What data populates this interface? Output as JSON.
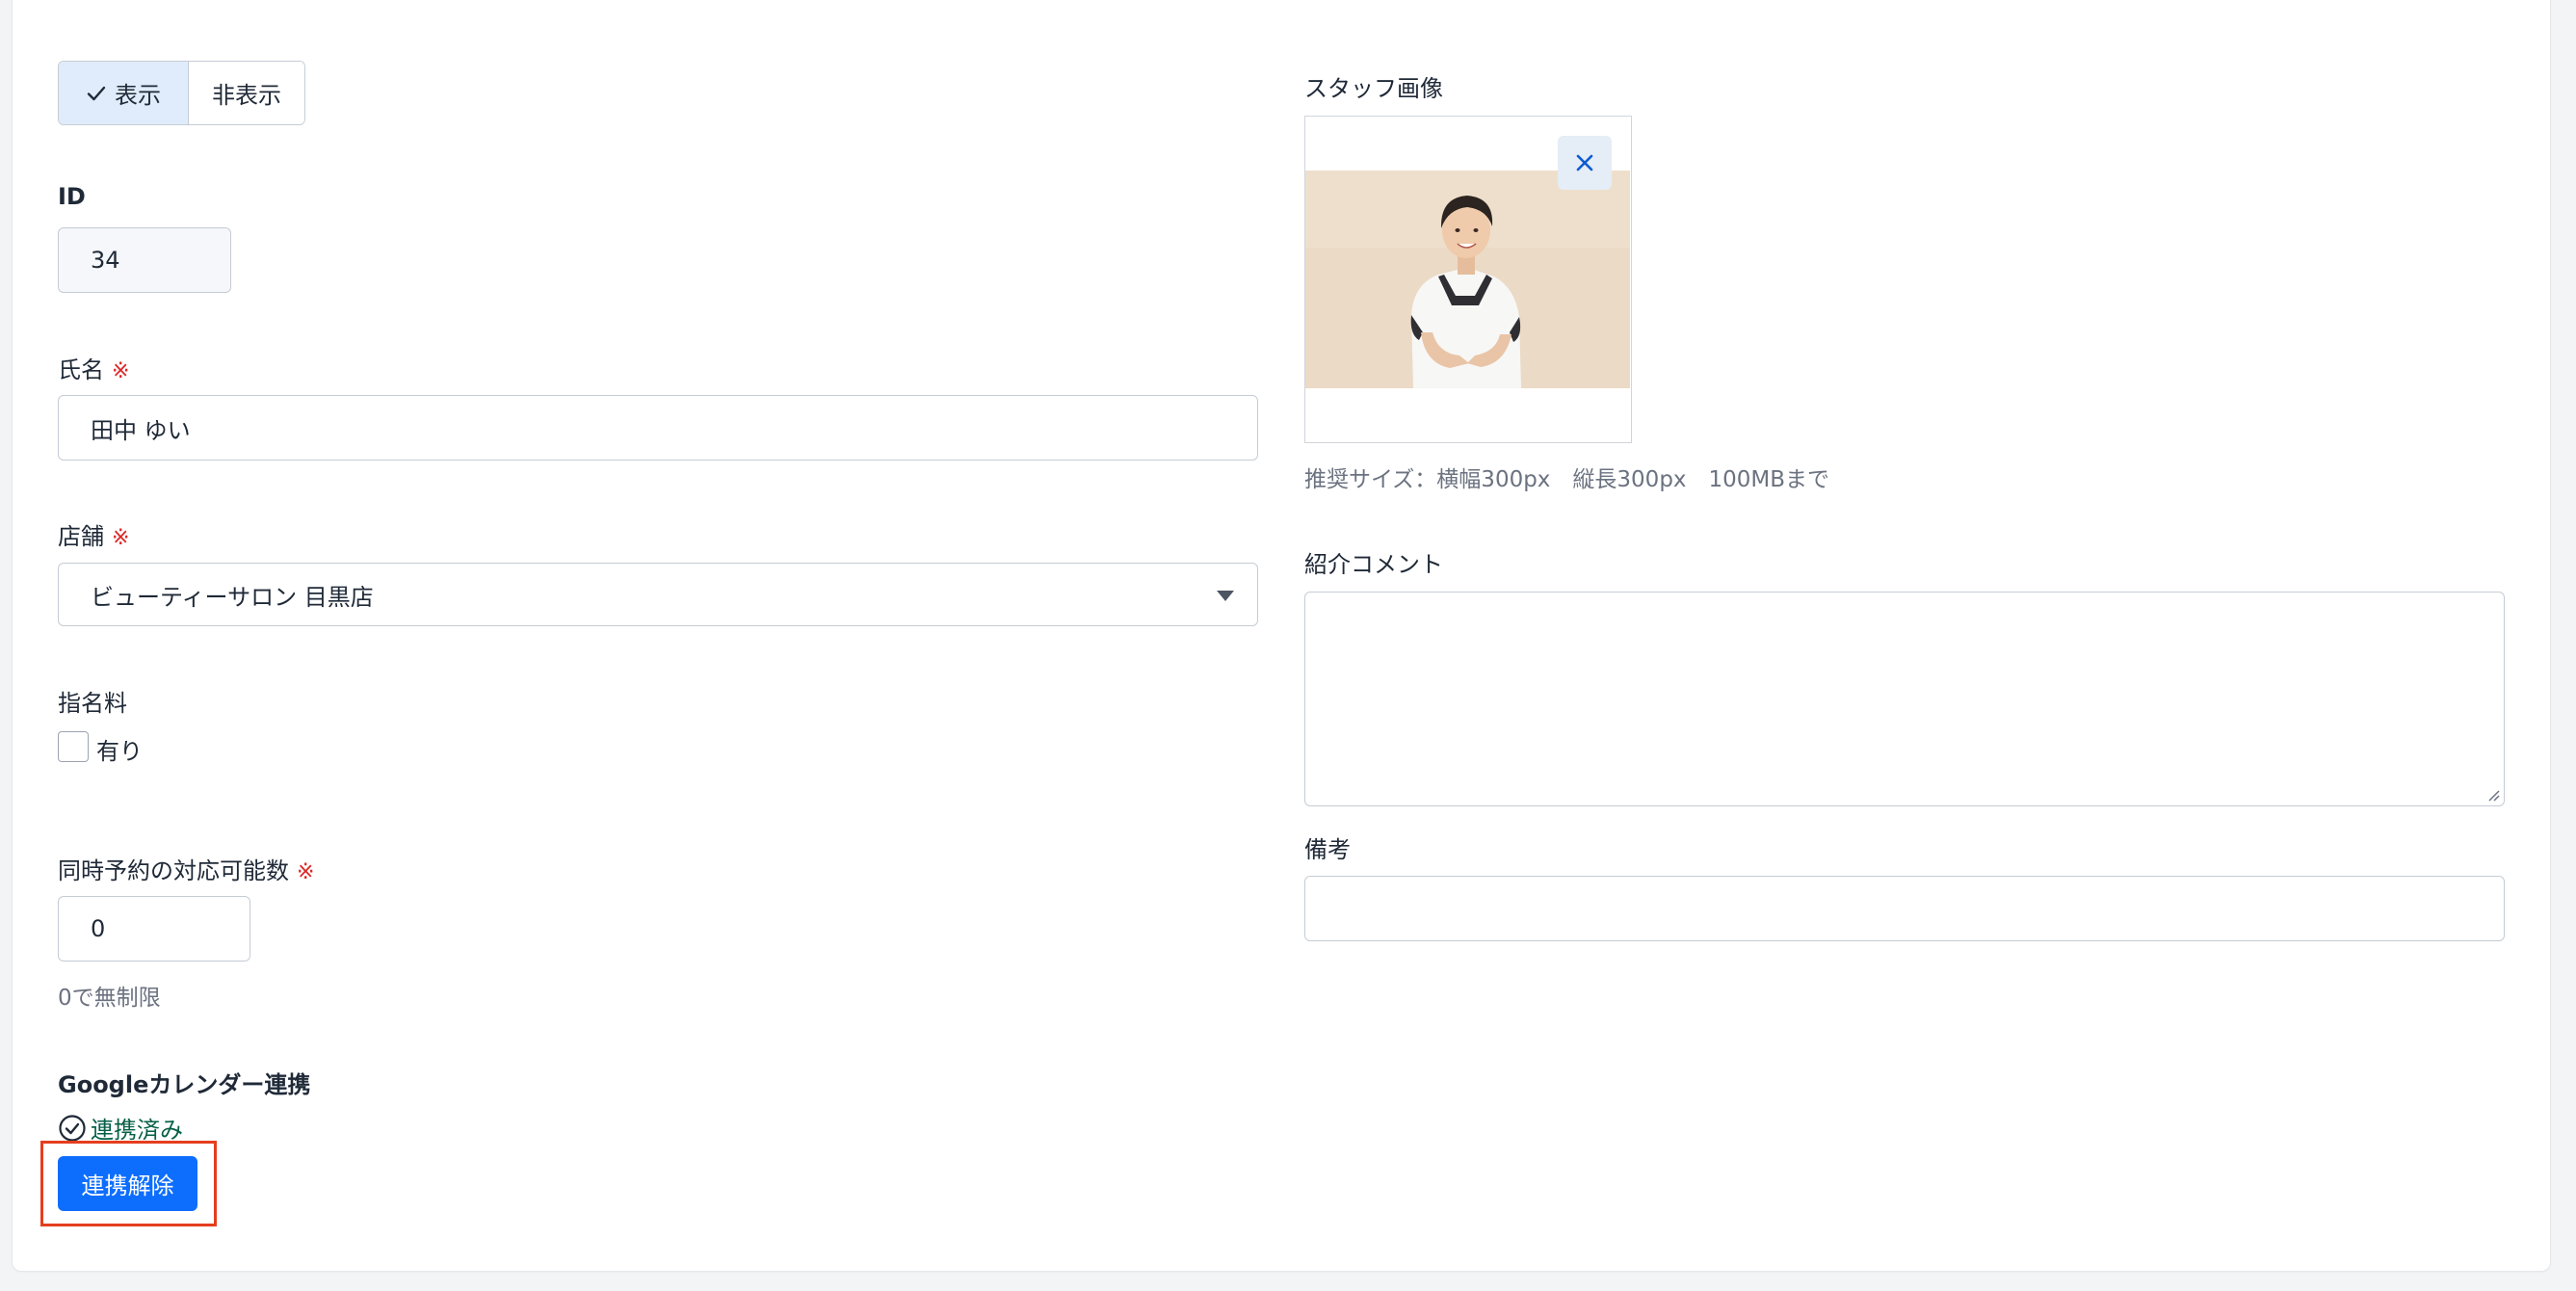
{
  "visibility_toggle": {
    "show_label": "表示",
    "hide_label": "非表示",
    "selected": "表示"
  },
  "id_field": {
    "label": "ID",
    "value": "34"
  },
  "name_field": {
    "label": "氏名",
    "required_mark": "※",
    "value": "田中 ゆい"
  },
  "store_field": {
    "label": "店舗",
    "required_mark": "※",
    "value": "ビューティーサロン 目黒店"
  },
  "nomination_fee": {
    "label": "指名料",
    "checkbox_label": "有り",
    "checked": false
  },
  "concurrent_bookings": {
    "label": "同時予約の対応可能数",
    "required_mark": "※",
    "value": "0",
    "hint": "0で無制限"
  },
  "google_calendar": {
    "label": "Googleカレンダー連携",
    "status": "連携済み",
    "unlink_button": "連携解除"
  },
  "staff_image": {
    "label": "スタッフ画像",
    "hint": "推奨サイズ：横幅300px　縦長300px　100MBまで"
  },
  "intro_comment": {
    "label": "紹介コメント",
    "value": ""
  },
  "notes": {
    "label": "備考",
    "value": ""
  },
  "colors": {
    "primary": "#0d6efd",
    "required": "#dc2626",
    "linked": "#065f46",
    "toggle_selected_bg": "#e0ecfb",
    "highlight": "#e53e1f"
  }
}
